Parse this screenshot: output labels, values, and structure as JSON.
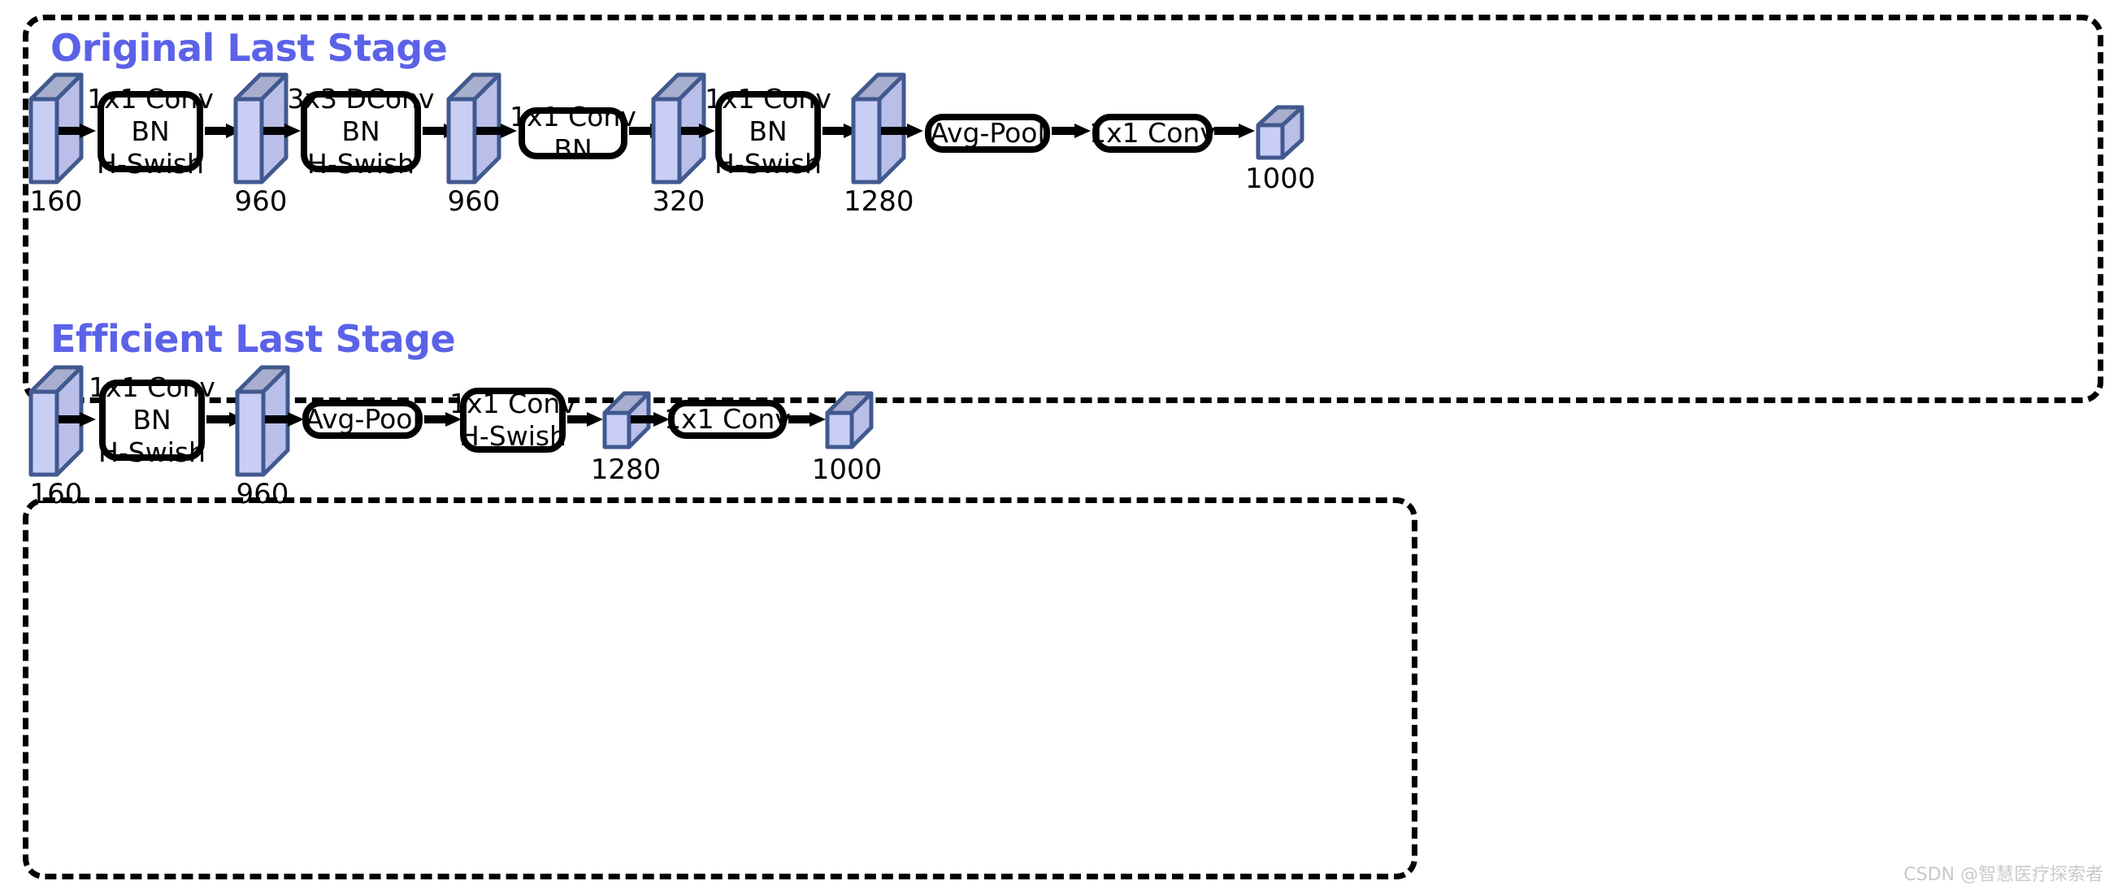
{
  "colors": {
    "title": "#5b62e8",
    "block_front": "#c9cef5",
    "block_top": "#a8aecd",
    "block_side": "#b9bfe8",
    "block_stroke": "#41598f",
    "outline": "#000000",
    "watermark": "#c9c9c9"
  },
  "panels": [
    {
      "id": "original",
      "title": "Original Last Stage",
      "nodes": [
        {
          "kind": "fmap",
          "label": "160",
          "name": "feature-map-160"
        },
        {
          "kind": "op",
          "lines": [
            "1x1 Conv",
            "BN",
            "H-Swish"
          ],
          "name": "op-1x1-conv-bn-hswish"
        },
        {
          "kind": "fmap",
          "label": "960",
          "name": "feature-map-960-a"
        },
        {
          "kind": "op",
          "lines": [
            "3x3 DConv",
            "BN",
            "H-Swish"
          ],
          "name": "op-3x3-dconv-bn-hswish"
        },
        {
          "kind": "fmap",
          "label": "960",
          "name": "feature-map-960-b"
        },
        {
          "kind": "op",
          "lines": [
            "1x1 Conv",
            "BN"
          ],
          "name": "op-1x1-conv-bn"
        },
        {
          "kind": "fmap",
          "label": "320",
          "name": "feature-map-320"
        },
        {
          "kind": "op",
          "lines": [
            "1x1 Conv",
            "BN",
            "H-Swish"
          ],
          "name": "op-1x1-conv-bn-hswish-2"
        },
        {
          "kind": "fmap",
          "label": "1280",
          "name": "feature-map-1280"
        },
        {
          "kind": "op",
          "lines": [
            "Avg-Pool"
          ],
          "name": "op-avg-pool"
        },
        {
          "kind": "op",
          "lines": [
            "1x1 Conv"
          ],
          "name": "op-1x1-conv"
        },
        {
          "kind": "fmap",
          "label": "1000",
          "name": "feature-map-1000"
        }
      ]
    },
    {
      "id": "efficient",
      "title": "Efficient Last Stage",
      "nodes": [
        {
          "kind": "fmap",
          "label": "160",
          "name": "feature-map-160"
        },
        {
          "kind": "op",
          "lines": [
            "1x1 Conv",
            "BN",
            "H-Swish"
          ],
          "name": "op-1x1-conv-bn-hswish"
        },
        {
          "kind": "fmap",
          "label": "960",
          "name": "feature-map-960"
        },
        {
          "kind": "op",
          "lines": [
            "Avg-Pool"
          ],
          "name": "op-avg-pool"
        },
        {
          "kind": "op",
          "lines": [
            "1x1 Conv",
            "H-Swish"
          ],
          "name": "op-1x1-conv-hswish"
        },
        {
          "kind": "fmap",
          "label": "1280",
          "name": "feature-map-1280"
        },
        {
          "kind": "op",
          "lines": [
            "1x1 Conv"
          ],
          "name": "op-1x1-conv"
        },
        {
          "kind": "fmap",
          "label": "1000",
          "name": "feature-map-1000"
        }
      ]
    }
  ],
  "watermark": "CSDN @智慧医疗探索者"
}
